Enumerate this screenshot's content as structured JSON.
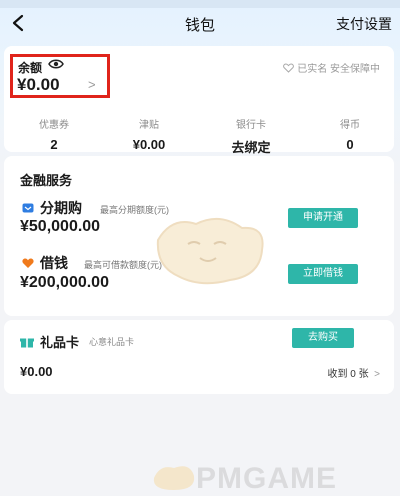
{
  "nav": {
    "title": "钱包",
    "right": "支付设置",
    "back_icon": "chevron-left-icon"
  },
  "balance": {
    "label": "余额",
    "value": "¥0.00",
    "arrow": ">",
    "verify_text": "已实名 安全保障中",
    "highlight_color": "#e0241b"
  },
  "stats": [
    {
      "label": "优惠券",
      "value": "2"
    },
    {
      "label": "津贴",
      "value": "¥0.00"
    },
    {
      "label": "银行卡",
      "value": "去绑定"
    },
    {
      "label": "得币",
      "value": "0"
    }
  ],
  "finance": {
    "title": "金融服务",
    "products": [
      {
        "name": "分期购",
        "desc": "最高分期额度(元)",
        "amount": "¥50,000.00",
        "button": "申请开通",
        "icon": "card-icon"
      },
      {
        "name": "借钱",
        "desc": "最高可借款额度(元)",
        "amount": "¥200,000.00",
        "button": "立即借钱",
        "icon": "heart-hands-icon"
      }
    ]
  },
  "gift": {
    "title": "礼品卡",
    "subtitle": "心意礼品卡",
    "button": "去购买",
    "amount": "¥0.00",
    "count": "收到 0 张"
  },
  "watermark": "PMGAME",
  "colors": {
    "accent": "#2eb6a9",
    "background": "#f3f4f7"
  }
}
